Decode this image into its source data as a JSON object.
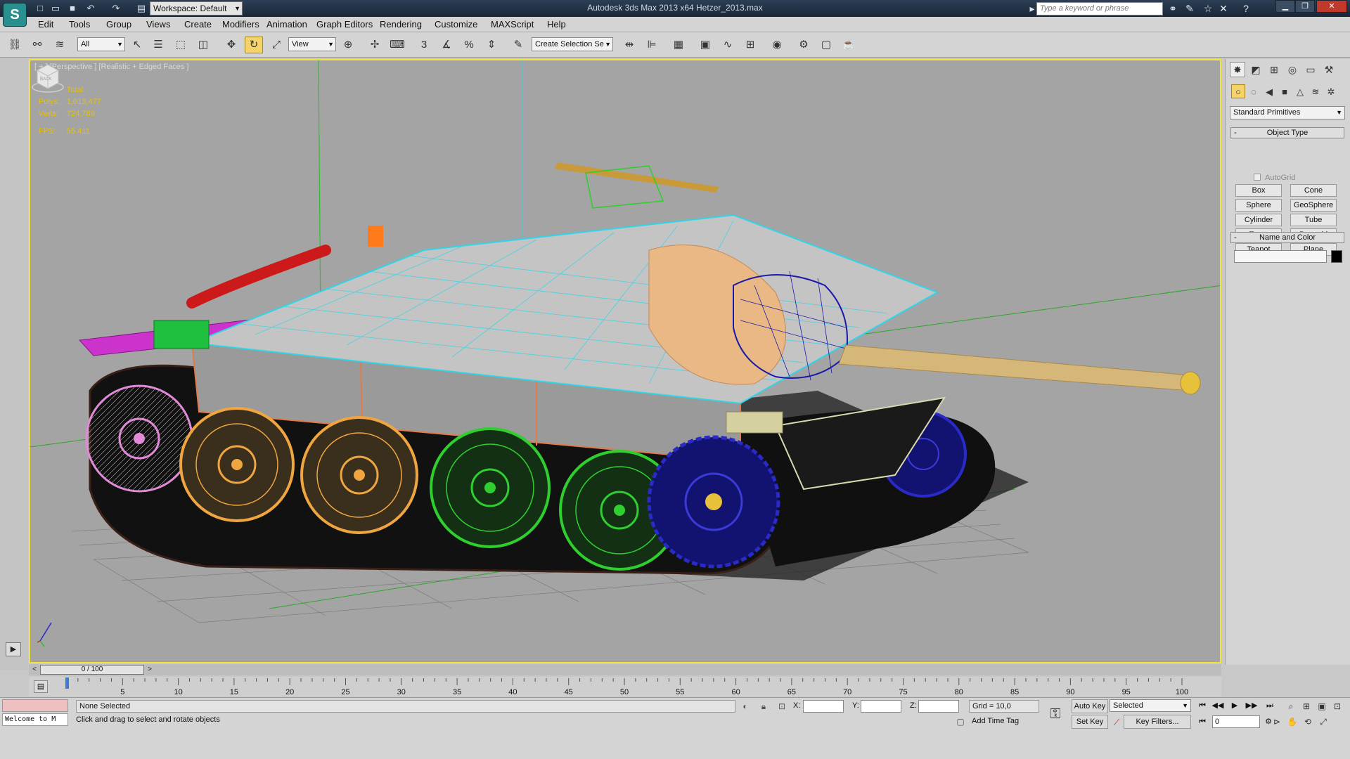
{
  "titlebar": {
    "title": "Autodesk 3ds Max  2013 x64      Hetzer_2013.max",
    "workspace": "Workspace: Default",
    "search_placeholder": "Type a keyword or phrase",
    "logo": "S"
  },
  "menu": [
    "Edit",
    "Tools",
    "Group",
    "Views",
    "Create",
    "Modifiers",
    "Animation",
    "Graph Editors",
    "Rendering",
    "Customize",
    "MAXScript",
    "Help"
  ],
  "toolbar": {
    "filter": "All",
    "ref_coord": "View",
    "selection_set": "Create Selection Se",
    "snap_label": "3"
  },
  "viewport": {
    "label": "[ + ] [Perspective ] [Realistic + Edged Faces ]",
    "stats": {
      "header": "Total",
      "polys_label": "Polys:",
      "polys": "1,013,477",
      "verts_label": "Verts:",
      "verts": "724,789",
      "fps_label": "FPS:",
      "fps": "55.411"
    },
    "viewcube_label": "BACK"
  },
  "command_panel": {
    "category": "Standard Primitives",
    "object_type_title": "Object Type",
    "autogrid": "AutoGrid",
    "buttons": [
      "Box",
      "Cone",
      "Sphere",
      "GeoSphere",
      "Cylinder",
      "Tube",
      "Torus",
      "Pyramid",
      "Teapot",
      "Plane"
    ],
    "name_color_title": "Name and Color"
  },
  "timeline": {
    "frame_display": "0 / 100",
    "ticks": [
      "5",
      "10",
      "15",
      "20",
      "25",
      "30",
      "35",
      "40",
      "45",
      "50",
      "55",
      "60",
      "65",
      "70",
      "75",
      "80",
      "85",
      "90",
      "95",
      "100"
    ]
  },
  "status": {
    "listener": "Welcome to M",
    "selection": "None Selected",
    "prompt": "Click and drag to select and rotate objects",
    "x_label": "X:",
    "y_label": "Y:",
    "z_label": "Z:",
    "grid": "Grid = 10,0",
    "add_time_tag": "Add Time Tag",
    "auto_key": "Auto Key",
    "set_key": "Set Key",
    "key_mode": "Selected",
    "key_filters": "Key Filters...",
    "current_frame": "0"
  },
  "colors": {
    "viewport_border": "#f2e33a",
    "stats": "#e8c100",
    "active_tool": "#f3d36a"
  }
}
